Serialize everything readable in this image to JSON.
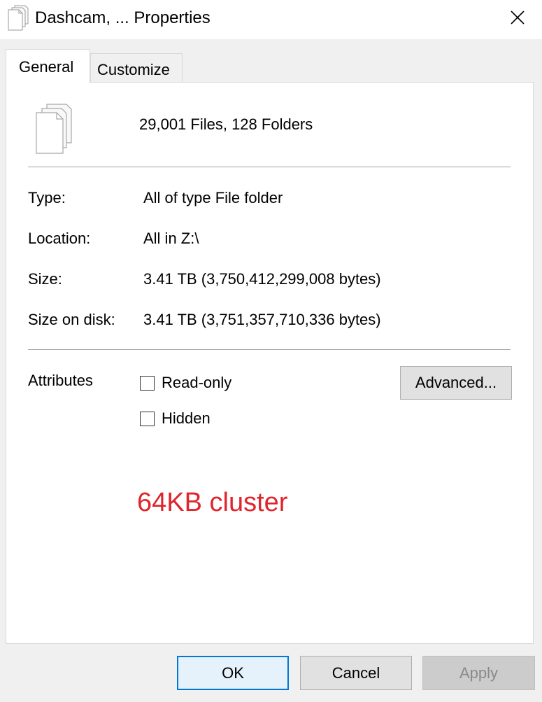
{
  "window": {
    "title": "Dashcam, ... Properties",
    "title_icon": "documents-icon",
    "close_icon": "close-icon"
  },
  "tabs": [
    {
      "label": "General",
      "active": true
    },
    {
      "label": "Customize",
      "active": false
    }
  ],
  "general": {
    "files_icon": "documents-icon",
    "summary": "29,001 Files, 128 Folders",
    "properties": [
      {
        "label": "Type:",
        "value": "All of type File folder"
      },
      {
        "label": "Location:",
        "value": "All in Z:\\"
      },
      {
        "label": "Size:",
        "value": "3.41 TB (3,750,412,299,008 bytes)"
      },
      {
        "label": "Size on disk:",
        "value": "3.41 TB (3,751,357,710,336 bytes)"
      }
    ],
    "attributes": {
      "label": "Attributes",
      "read_only": {
        "label": "Read-only",
        "checked": false
      },
      "hidden": {
        "label": "Hidden",
        "checked": false
      },
      "advanced_label": "Advanced..."
    },
    "annotation": {
      "text": "64KB cluster",
      "color": "#e0242b"
    }
  },
  "buttons": {
    "ok": "OK",
    "cancel": "Cancel",
    "apply": "Apply",
    "apply_enabled": false
  },
  "colors": {
    "accent": "#0078d7",
    "disabled_text": "#8a8a8a",
    "annotation": "#e0242b"
  }
}
